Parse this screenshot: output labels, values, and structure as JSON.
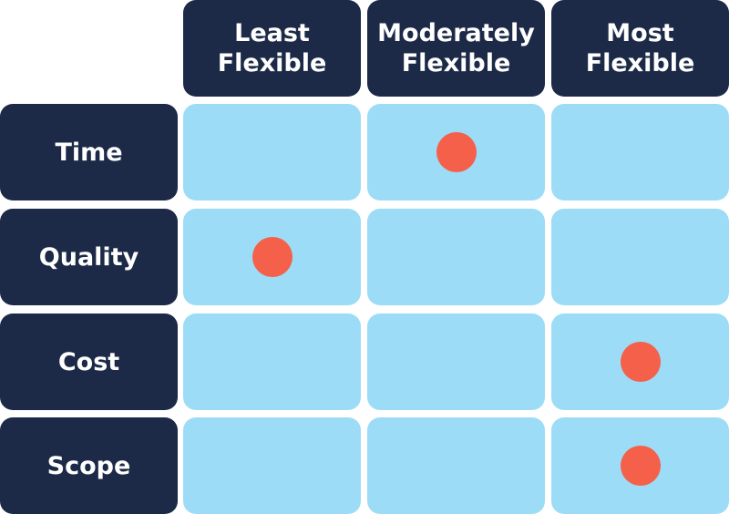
{
  "columns": [
    {
      "label_line1": "Least",
      "label_line2": "Flexible"
    },
    {
      "label_line1": "Moderately",
      "label_line2": "Flexible"
    },
    {
      "label_line1": "Most",
      "label_line2": "Flexible"
    }
  ],
  "rows": [
    {
      "label": "Time",
      "marked_column": 1
    },
    {
      "label": "Quality",
      "marked_column": 0
    },
    {
      "label": "Cost",
      "marked_column": 2
    },
    {
      "label": "Scope",
      "marked_column": 2
    }
  ],
  "colors": {
    "header": "#1c2a47",
    "cell": "#9ddcf6",
    "marker": "#f4604a"
  }
}
